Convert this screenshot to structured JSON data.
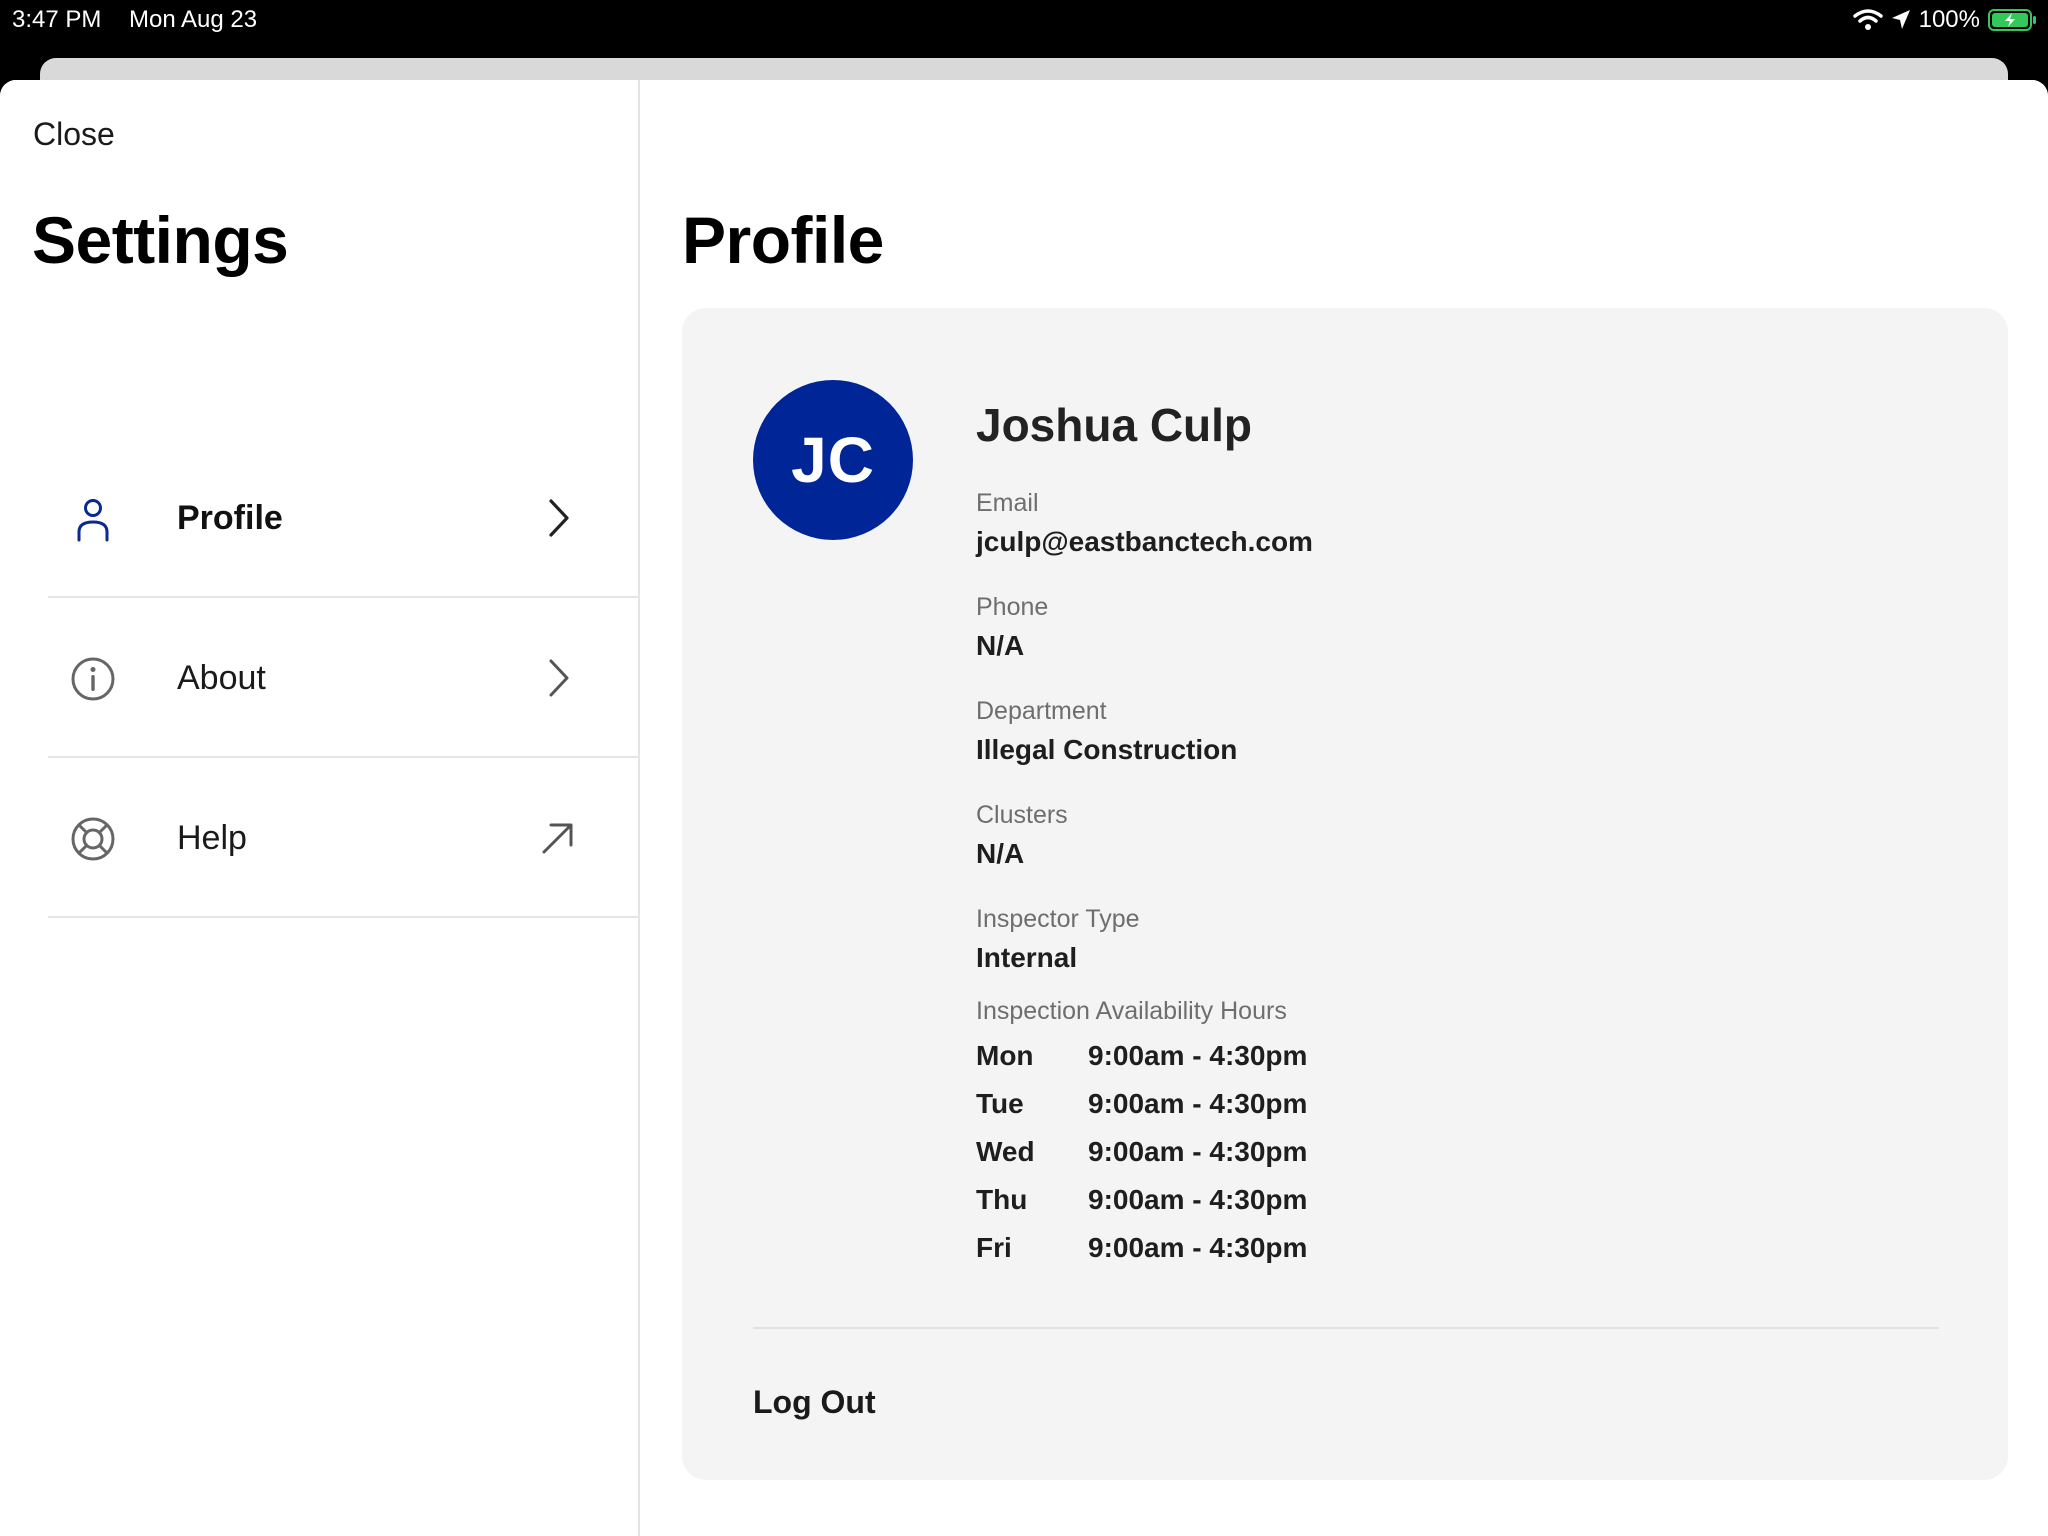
{
  "status_bar": {
    "time": "3:47 PM",
    "date": "Mon Aug 23",
    "battery": "100%"
  },
  "sidebar": {
    "close_label": "Close",
    "title": "Settings",
    "items": [
      {
        "label": "Profile",
        "icon": "person-icon",
        "trailing": "chevron-right-icon",
        "active": true
      },
      {
        "label": "About",
        "icon": "info-icon",
        "trailing": "chevron-right-icon",
        "active": false
      },
      {
        "label": "Help",
        "icon": "lifebuoy-icon",
        "trailing": "external-arrow-icon",
        "active": false
      }
    ]
  },
  "profile": {
    "title": "Profile",
    "initials": "JC",
    "name": "Joshua Culp",
    "fields": [
      {
        "label": "Email",
        "value": "jculp@eastbanctech.com"
      },
      {
        "label": "Phone",
        "value": "N/A"
      },
      {
        "label": "Department",
        "value": "Illegal Construction"
      },
      {
        "label": "Clusters",
        "value": "N/A"
      },
      {
        "label": "Inspector Type",
        "value": "Internal"
      }
    ],
    "hours_label": "Inspection Availability Hours",
    "hours": [
      {
        "day": "Mon",
        "time": "9:00am - 4:30pm"
      },
      {
        "day": "Tue",
        "time": "9:00am - 4:30pm"
      },
      {
        "day": "Wed",
        "time": "9:00am - 4:30pm"
      },
      {
        "day": "Thu",
        "time": "9:00am - 4:30pm"
      },
      {
        "day": "Fri",
        "time": "9:00am - 4:30pm"
      }
    ],
    "logout_label": "Log Out"
  },
  "colors": {
    "avatar_bg": "#002597",
    "accent_icon": "#0a2a8f",
    "battery_green": "#34c759"
  }
}
